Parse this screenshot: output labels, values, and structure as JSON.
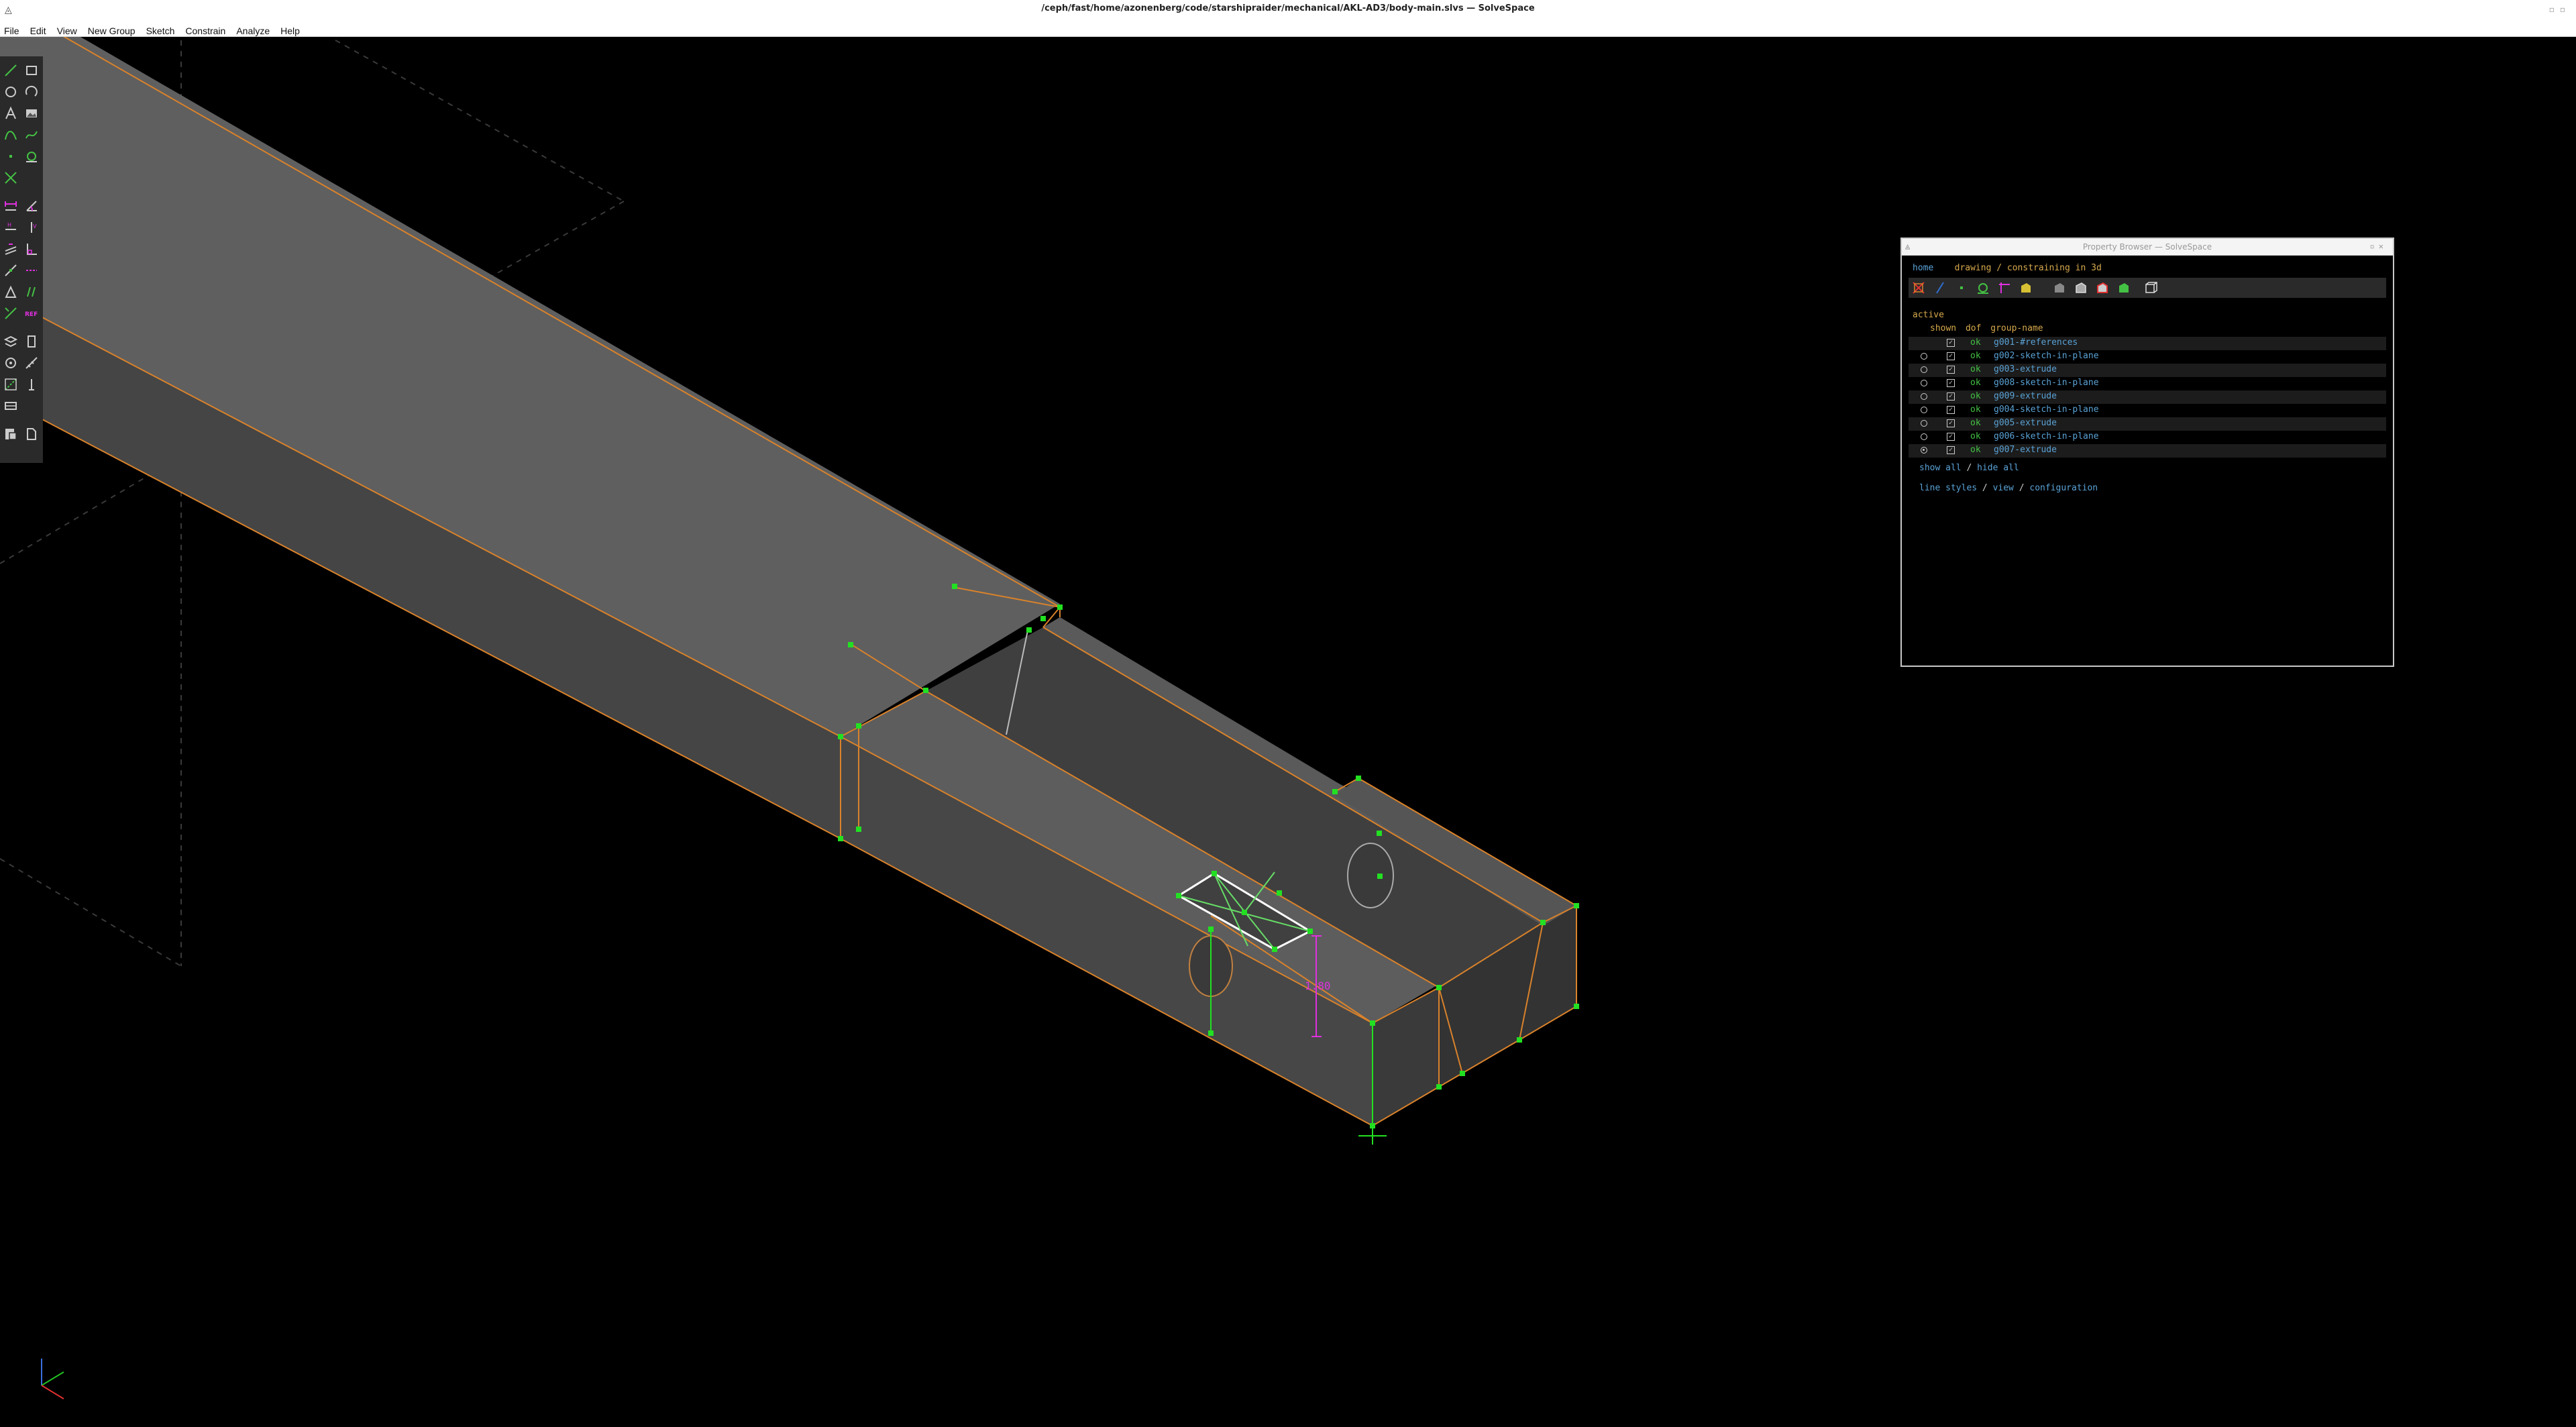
{
  "window": {
    "title": "/ceph/fast/home/azonenberg/code/starshipraider/mechanical/AKL-AD3/body-main.slvs — SolveSpace"
  },
  "menu": [
    "File",
    "Edit",
    "View",
    "New Group",
    "Sketch",
    "Constrain",
    "Analyze",
    "Help"
  ],
  "colors": {
    "background": "#000000",
    "edge": "#d9822b",
    "point": "#22e022",
    "constraint": "#e030e0",
    "link": "#5aa2d6",
    "label": "#d7a94d",
    "ok": "#44c144"
  },
  "toolbar": {
    "tools": [
      "line-segment",
      "rectangle",
      "circle",
      "arc",
      "text",
      "image",
      "cubic-spline",
      "bezier",
      "point",
      "tangent-arc",
      "split-curves",
      "distance",
      "angle",
      "horizontal",
      "vertical",
      "parallel",
      "perpendicular",
      "point-on-line",
      "symmetric",
      "equal",
      "midpoint",
      "comment",
      "reference",
      "workplane",
      "nearest-ortho",
      "step-rotate",
      "step-translate",
      "construction",
      "extrude-group",
      "assemble",
      "sketch-in-3d"
    ],
    "ref_label": "REF"
  },
  "viewport": {
    "dimension_label": "1.80"
  },
  "property_browser": {
    "title": "Property Browser — SolveSpace",
    "nav": {
      "home": "home",
      "status": "drawing / constraining in 3d"
    },
    "active_label": "active",
    "columns": {
      "shown": "shown",
      "dof": "dof",
      "name": "group-name"
    },
    "groups": [
      {
        "name": "g001-#references",
        "dof": "ok",
        "active": false,
        "has_radio": false
      },
      {
        "name": "g002-sketch-in-plane",
        "dof": "ok",
        "active": false,
        "has_radio": true
      },
      {
        "name": "g003-extrude",
        "dof": "ok",
        "active": false,
        "has_radio": true
      },
      {
        "name": "g008-sketch-in-plane",
        "dof": "ok",
        "active": false,
        "has_radio": true
      },
      {
        "name": "g009-extrude",
        "dof": "ok",
        "active": false,
        "has_radio": true
      },
      {
        "name": "g004-sketch-in-plane",
        "dof": "ok",
        "active": false,
        "has_radio": true
      },
      {
        "name": "g005-extrude",
        "dof": "ok",
        "active": false,
        "has_radio": true
      },
      {
        "name": "g006-sketch-in-plane",
        "dof": "ok",
        "active": false,
        "has_radio": true
      },
      {
        "name": "g007-extrude",
        "dof": "ok",
        "active": true,
        "has_radio": true
      }
    ],
    "show_all": "show all",
    "hide_all": "hide all",
    "line_styles": "line styles",
    "view": "view",
    "configuration": "configuration"
  }
}
